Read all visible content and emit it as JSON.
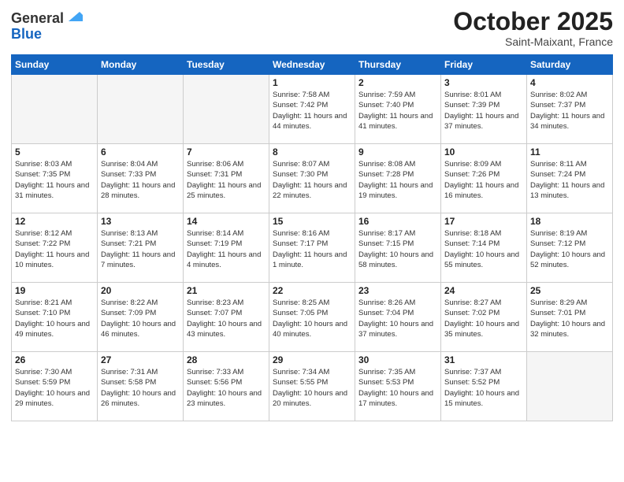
{
  "header": {
    "logo_general": "General",
    "logo_blue": "Blue",
    "month": "October 2025",
    "location": "Saint-Maixant, France"
  },
  "days_of_week": [
    "Sunday",
    "Monday",
    "Tuesday",
    "Wednesday",
    "Thursday",
    "Friday",
    "Saturday"
  ],
  "weeks": [
    [
      {
        "day": "",
        "sunrise": "",
        "sunset": "",
        "daylight": ""
      },
      {
        "day": "",
        "sunrise": "",
        "sunset": "",
        "daylight": ""
      },
      {
        "day": "",
        "sunrise": "",
        "sunset": "",
        "daylight": ""
      },
      {
        "day": "1",
        "sunrise": "Sunrise: 7:58 AM",
        "sunset": "Sunset: 7:42 PM",
        "daylight": "Daylight: 11 hours and 44 minutes."
      },
      {
        "day": "2",
        "sunrise": "Sunrise: 7:59 AM",
        "sunset": "Sunset: 7:40 PM",
        "daylight": "Daylight: 11 hours and 41 minutes."
      },
      {
        "day": "3",
        "sunrise": "Sunrise: 8:01 AM",
        "sunset": "Sunset: 7:39 PM",
        "daylight": "Daylight: 11 hours and 37 minutes."
      },
      {
        "day": "4",
        "sunrise": "Sunrise: 8:02 AM",
        "sunset": "Sunset: 7:37 PM",
        "daylight": "Daylight: 11 hours and 34 minutes."
      }
    ],
    [
      {
        "day": "5",
        "sunrise": "Sunrise: 8:03 AM",
        "sunset": "Sunset: 7:35 PM",
        "daylight": "Daylight: 11 hours and 31 minutes."
      },
      {
        "day": "6",
        "sunrise": "Sunrise: 8:04 AM",
        "sunset": "Sunset: 7:33 PM",
        "daylight": "Daylight: 11 hours and 28 minutes."
      },
      {
        "day": "7",
        "sunrise": "Sunrise: 8:06 AM",
        "sunset": "Sunset: 7:31 PM",
        "daylight": "Daylight: 11 hours and 25 minutes."
      },
      {
        "day": "8",
        "sunrise": "Sunrise: 8:07 AM",
        "sunset": "Sunset: 7:30 PM",
        "daylight": "Daylight: 11 hours and 22 minutes."
      },
      {
        "day": "9",
        "sunrise": "Sunrise: 8:08 AM",
        "sunset": "Sunset: 7:28 PM",
        "daylight": "Daylight: 11 hours and 19 minutes."
      },
      {
        "day": "10",
        "sunrise": "Sunrise: 8:09 AM",
        "sunset": "Sunset: 7:26 PM",
        "daylight": "Daylight: 11 hours and 16 minutes."
      },
      {
        "day": "11",
        "sunrise": "Sunrise: 8:11 AM",
        "sunset": "Sunset: 7:24 PM",
        "daylight": "Daylight: 11 hours and 13 minutes."
      }
    ],
    [
      {
        "day": "12",
        "sunrise": "Sunrise: 8:12 AM",
        "sunset": "Sunset: 7:22 PM",
        "daylight": "Daylight: 11 hours and 10 minutes."
      },
      {
        "day": "13",
        "sunrise": "Sunrise: 8:13 AM",
        "sunset": "Sunset: 7:21 PM",
        "daylight": "Daylight: 11 hours and 7 minutes."
      },
      {
        "day": "14",
        "sunrise": "Sunrise: 8:14 AM",
        "sunset": "Sunset: 7:19 PM",
        "daylight": "Daylight: 11 hours and 4 minutes."
      },
      {
        "day": "15",
        "sunrise": "Sunrise: 8:16 AM",
        "sunset": "Sunset: 7:17 PM",
        "daylight": "Daylight: 11 hours and 1 minute."
      },
      {
        "day": "16",
        "sunrise": "Sunrise: 8:17 AM",
        "sunset": "Sunset: 7:15 PM",
        "daylight": "Daylight: 10 hours and 58 minutes."
      },
      {
        "day": "17",
        "sunrise": "Sunrise: 8:18 AM",
        "sunset": "Sunset: 7:14 PM",
        "daylight": "Daylight: 10 hours and 55 minutes."
      },
      {
        "day": "18",
        "sunrise": "Sunrise: 8:19 AM",
        "sunset": "Sunset: 7:12 PM",
        "daylight": "Daylight: 10 hours and 52 minutes."
      }
    ],
    [
      {
        "day": "19",
        "sunrise": "Sunrise: 8:21 AM",
        "sunset": "Sunset: 7:10 PM",
        "daylight": "Daylight: 10 hours and 49 minutes."
      },
      {
        "day": "20",
        "sunrise": "Sunrise: 8:22 AM",
        "sunset": "Sunset: 7:09 PM",
        "daylight": "Daylight: 10 hours and 46 minutes."
      },
      {
        "day": "21",
        "sunrise": "Sunrise: 8:23 AM",
        "sunset": "Sunset: 7:07 PM",
        "daylight": "Daylight: 10 hours and 43 minutes."
      },
      {
        "day": "22",
        "sunrise": "Sunrise: 8:25 AM",
        "sunset": "Sunset: 7:05 PM",
        "daylight": "Daylight: 10 hours and 40 minutes."
      },
      {
        "day": "23",
        "sunrise": "Sunrise: 8:26 AM",
        "sunset": "Sunset: 7:04 PM",
        "daylight": "Daylight: 10 hours and 37 minutes."
      },
      {
        "day": "24",
        "sunrise": "Sunrise: 8:27 AM",
        "sunset": "Sunset: 7:02 PM",
        "daylight": "Daylight: 10 hours and 35 minutes."
      },
      {
        "day": "25",
        "sunrise": "Sunrise: 8:29 AM",
        "sunset": "Sunset: 7:01 PM",
        "daylight": "Daylight: 10 hours and 32 minutes."
      }
    ],
    [
      {
        "day": "26",
        "sunrise": "Sunrise: 7:30 AM",
        "sunset": "Sunset: 5:59 PM",
        "daylight": "Daylight: 10 hours and 29 minutes."
      },
      {
        "day": "27",
        "sunrise": "Sunrise: 7:31 AM",
        "sunset": "Sunset: 5:58 PM",
        "daylight": "Daylight: 10 hours and 26 minutes."
      },
      {
        "day": "28",
        "sunrise": "Sunrise: 7:33 AM",
        "sunset": "Sunset: 5:56 PM",
        "daylight": "Daylight: 10 hours and 23 minutes."
      },
      {
        "day": "29",
        "sunrise": "Sunrise: 7:34 AM",
        "sunset": "Sunset: 5:55 PM",
        "daylight": "Daylight: 10 hours and 20 minutes."
      },
      {
        "day": "30",
        "sunrise": "Sunrise: 7:35 AM",
        "sunset": "Sunset: 5:53 PM",
        "daylight": "Daylight: 10 hours and 17 minutes."
      },
      {
        "day": "31",
        "sunrise": "Sunrise: 7:37 AM",
        "sunset": "Sunset: 5:52 PM",
        "daylight": "Daylight: 10 hours and 15 minutes."
      },
      {
        "day": "",
        "sunrise": "",
        "sunset": "",
        "daylight": ""
      }
    ]
  ]
}
